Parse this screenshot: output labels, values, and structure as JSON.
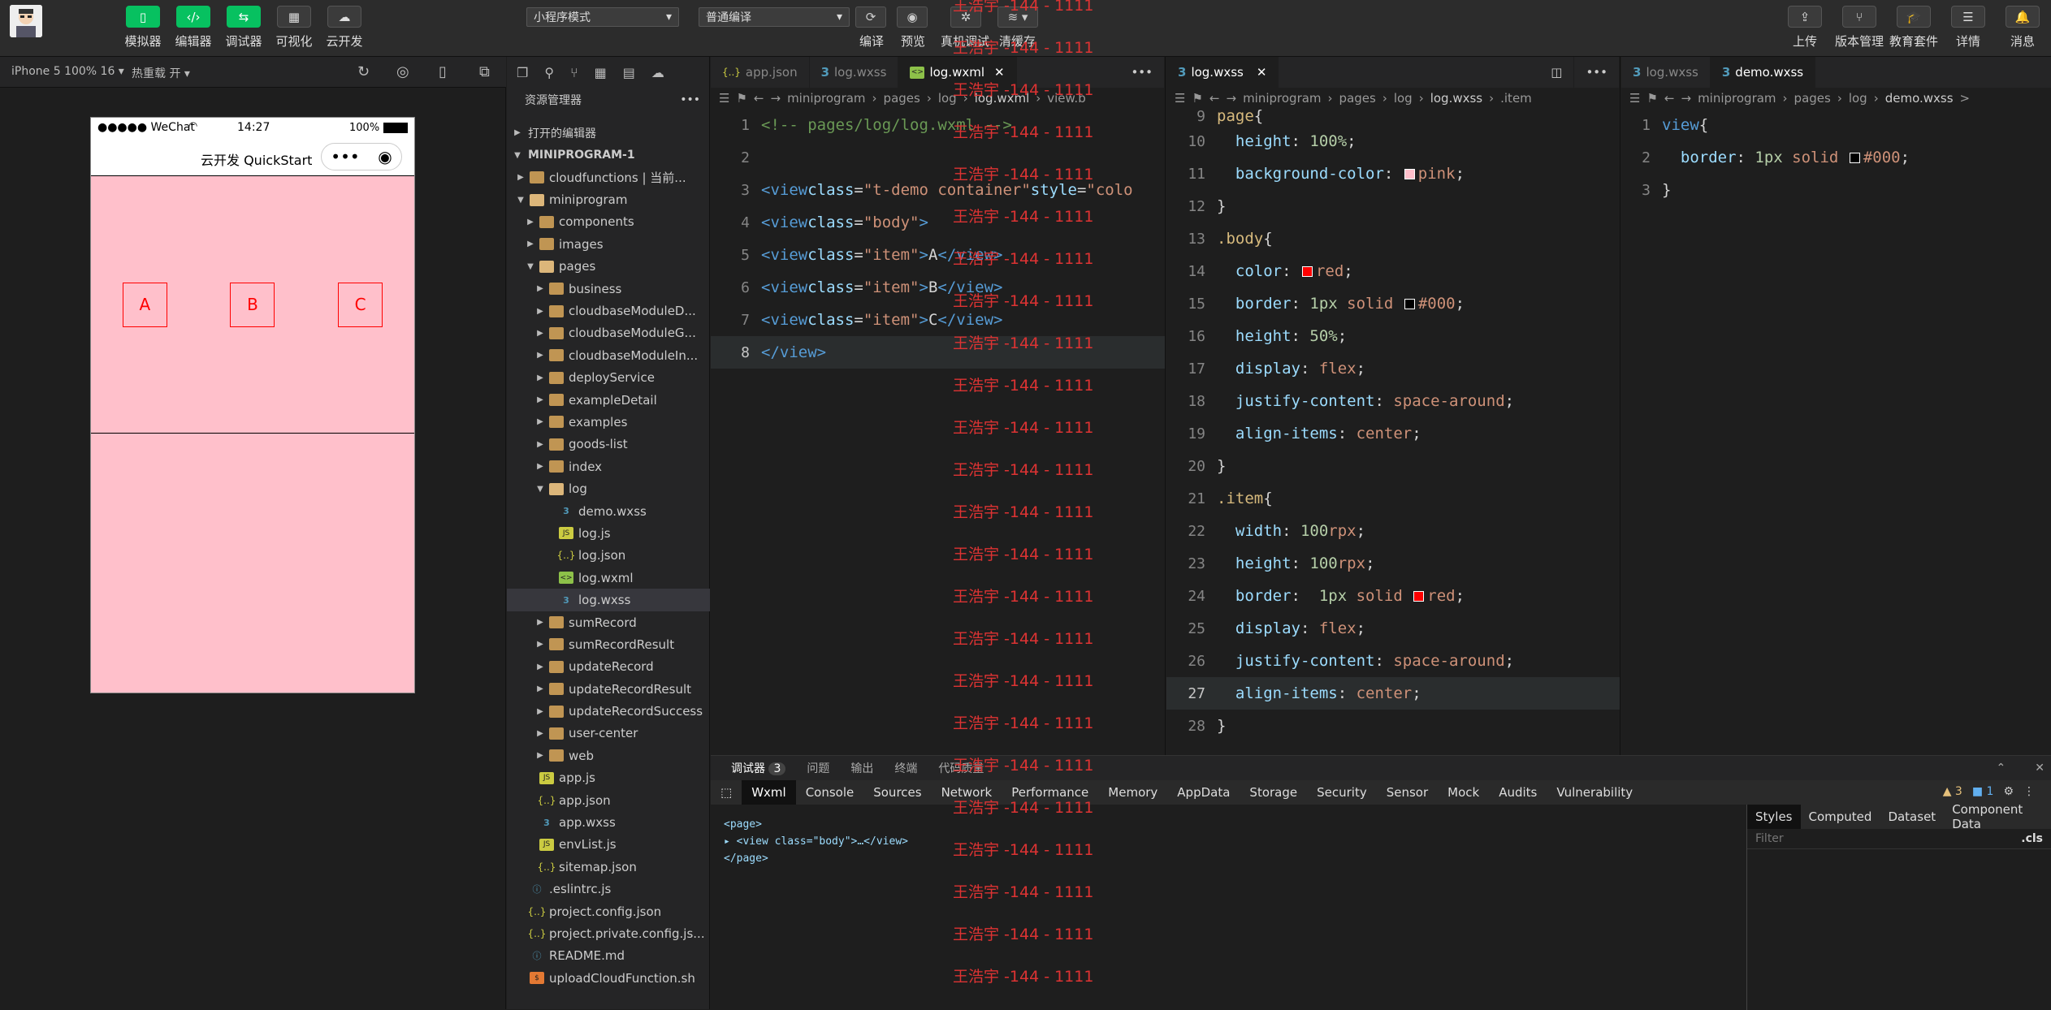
{
  "toolbar": {
    "left_buttons": [
      {
        "label": "模拟器",
        "icon": "phone-icon"
      },
      {
        "label": "编辑器",
        "icon": "code-icon"
      },
      {
        "label": "调试器",
        "icon": "debug-icon"
      },
      {
        "label": "可视化",
        "icon": "layout-icon"
      },
      {
        "label": "云开发",
        "icon": "cloud-icon"
      }
    ],
    "mode_select": "小程序模式",
    "compile_select": "普通编译",
    "center_buttons": [
      "编译",
      "预览",
      "真机调试",
      "清缓存"
    ],
    "right_buttons": [
      "上传",
      "版本管理",
      "教育套件",
      "详情",
      "消息"
    ]
  },
  "simulator": {
    "device": "iPhone 5 100% 16",
    "hot_reload": "热重载 开",
    "status_left": "●●●●● WeChat",
    "status_time": "14:27",
    "status_battery": "100%",
    "nav_title": "云开发 QuickStart",
    "capsule_more": "•••",
    "items": [
      "A",
      "B",
      "C"
    ]
  },
  "explorer": {
    "title": "资源管理器",
    "sections": [
      "打开的编辑器",
      "MINIPROGRAM-1"
    ],
    "tree": [
      {
        "label": "cloudfunctions | 当前...",
        "type": "folder",
        "depth": 1,
        "caret": "right"
      },
      {
        "label": "miniprogram",
        "type": "folder",
        "depth": 1,
        "caret": "down"
      },
      {
        "label": "components",
        "type": "folder",
        "depth": 2,
        "caret": "right"
      },
      {
        "label": "images",
        "type": "folder",
        "depth": 2,
        "caret": "right"
      },
      {
        "label": "pages",
        "type": "folder",
        "depth": 2,
        "caret": "down"
      },
      {
        "label": "business",
        "type": "folder",
        "depth": 3,
        "caret": "right"
      },
      {
        "label": "cloudbaseModuleD...",
        "type": "folder",
        "depth": 3,
        "caret": "right"
      },
      {
        "label": "cloudbaseModuleG...",
        "type": "folder",
        "depth": 3,
        "caret": "right"
      },
      {
        "label": "cloudbaseModuleIn...",
        "type": "folder",
        "depth": 3,
        "caret": "right"
      },
      {
        "label": "deployService",
        "type": "folder",
        "depth": 3,
        "caret": "right"
      },
      {
        "label": "exampleDetail",
        "type": "folder",
        "depth": 3,
        "caret": "right"
      },
      {
        "label": "examples",
        "type": "folder",
        "depth": 3,
        "caret": "right"
      },
      {
        "label": "goods-list",
        "type": "folder",
        "depth": 3,
        "caret": "right"
      },
      {
        "label": "index",
        "type": "folder",
        "depth": 3,
        "caret": "right"
      },
      {
        "label": "log",
        "type": "folder",
        "depth": 3,
        "caret": "down"
      },
      {
        "label": "demo.wxss",
        "type": "css",
        "depth": 4
      },
      {
        "label": "log.js",
        "type": "js",
        "depth": 4
      },
      {
        "label": "log.json",
        "type": "json",
        "depth": 4
      },
      {
        "label": "log.wxml",
        "type": "wxml",
        "depth": 4
      },
      {
        "label": "log.wxss",
        "type": "css",
        "depth": 4,
        "selected": true
      },
      {
        "label": "sumRecord",
        "type": "folder",
        "depth": 3,
        "caret": "right"
      },
      {
        "label": "sumRecordResult",
        "type": "folder",
        "depth": 3,
        "caret": "right"
      },
      {
        "label": "updateRecord",
        "type": "folder",
        "depth": 3,
        "caret": "right"
      },
      {
        "label": "updateRecordResult",
        "type": "folder",
        "depth": 3,
        "caret": "right"
      },
      {
        "label": "updateRecordSuccess",
        "type": "folder",
        "depth": 3,
        "caret": "right"
      },
      {
        "label": "user-center",
        "type": "folder",
        "depth": 3,
        "caret": "right"
      },
      {
        "label": "web",
        "type": "folder",
        "depth": 3,
        "caret": "right"
      },
      {
        "label": "app.js",
        "type": "js",
        "depth": 2
      },
      {
        "label": "app.json",
        "type": "json",
        "depth": 2
      },
      {
        "label": "app.wxss",
        "type": "css",
        "depth": 2
      },
      {
        "label": "envList.js",
        "type": "js",
        "depth": 2
      },
      {
        "label": "sitemap.json",
        "type": "json",
        "depth": 2
      },
      {
        "label": ".eslintrc.js",
        "type": "info",
        "depth": 1
      },
      {
        "label": "project.config.json",
        "type": "json",
        "depth": 1
      },
      {
        "label": "project.private.config.js...",
        "type": "json",
        "depth": 1
      },
      {
        "label": "README.md",
        "type": "info",
        "depth": 1
      },
      {
        "label": "uploadCloudFunction.sh",
        "type": "sh",
        "depth": 1
      }
    ]
  },
  "editor1": {
    "tabs": [
      {
        "label": "app.json",
        "active": false
      },
      {
        "label": "log.wxss",
        "active": false
      },
      {
        "label": "log.wxml",
        "active": true
      }
    ],
    "breadcrumb": [
      "miniprogram",
      "pages",
      "log",
      "log.wxml",
      "view.b"
    ],
    "line_numbers": [
      "1",
      "2",
      "3",
      "4",
      "5",
      "6",
      "7",
      "8"
    ]
  },
  "editor2": {
    "tabs": [
      {
        "label": "log.wxss",
        "active": true
      }
    ],
    "breadcrumb": [
      "miniprogram",
      "pages",
      "log",
      "log.wxss",
      ".item"
    ],
    "line_numbers": [
      "9",
      "10",
      "11",
      "12",
      "13",
      "14",
      "15",
      "16",
      "17",
      "18",
      "19",
      "20",
      "21",
      "22",
      "23",
      "24",
      "25",
      "26",
      "27",
      "28"
    ]
  },
  "editor3": {
    "tabs": [
      {
        "label": "log.wxss",
        "active": false
      },
      {
        "label": "demo.wxss",
        "active": true
      }
    ],
    "breadcrumb": [
      "miniprogram",
      "pages",
      "log",
      "demo.wxss",
      ">"
    ],
    "line_numbers": [
      "1",
      "2",
      "3"
    ]
  },
  "debugger": {
    "top_tabs": [
      "调试器",
      "3",
      "问题",
      "输出",
      "终端",
      "代码质量"
    ],
    "tabs": [
      "Wxml",
      "Console",
      "Sources",
      "Network",
      "Performance",
      "Memory",
      "AppData",
      "Storage",
      "Security",
      "Sensor",
      "Mock",
      "Audits",
      "Vulnerability"
    ],
    "warnings": "▲ 3",
    "messages": "■ 1",
    "dom": [
      "<page>",
      "▸ <view class=\"body\">…</view>",
      "</page>"
    ],
    "styles_tabs": [
      "Styles",
      "Computed",
      "Dataset",
      "Component Data"
    ],
    "filter_placeholder": "Filter",
    "cls": ".cls"
  },
  "watermark": "王浩宇 -144 - 1111",
  "colors": {
    "accent_green": "#07c160",
    "pink": "#ffc0cb",
    "red": "#ff0000"
  }
}
